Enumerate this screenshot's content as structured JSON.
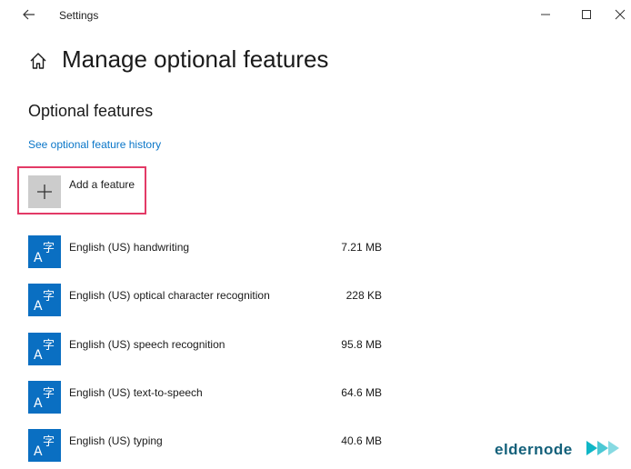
{
  "window": {
    "title": "Settings"
  },
  "page": {
    "title": "Manage optional features",
    "section_title": "Optional features"
  },
  "history_link": "See optional feature history",
  "add_feature": {
    "label": "Add a feature"
  },
  "features": [
    {
      "name": "English (US) handwriting",
      "size": "7.21 MB",
      "icon": "language-icon"
    },
    {
      "name": "English (US) optical character recognition",
      "size": "228 KB",
      "icon": "language-icon"
    },
    {
      "name": "English (US) speech recognition",
      "size": "95.8 MB",
      "icon": "language-icon"
    },
    {
      "name": "English (US) text-to-speech",
      "size": "64.6 MB",
      "icon": "language-icon"
    },
    {
      "name": "English (US) typing",
      "size": "40.6 MB",
      "icon": "language-icon"
    }
  ],
  "watermark": {
    "text": "eldernode"
  },
  "colors": {
    "accent": "#0a6fc2",
    "link": "#0a76c8",
    "highlight": "#e33a66",
    "watermark": "#13607a"
  }
}
